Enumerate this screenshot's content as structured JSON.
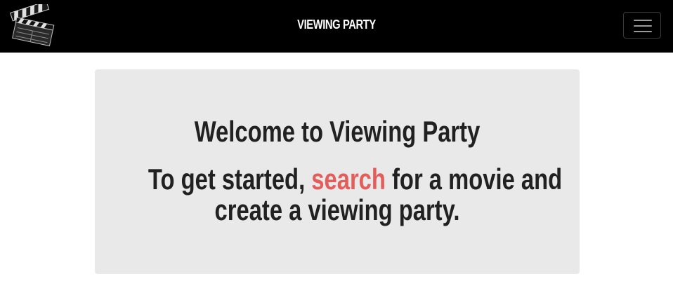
{
  "navbar": {
    "brand": "VIEWING PARTY",
    "logo_icon": "clapperboard-icon",
    "toggle_icon": "hamburger-menu-icon"
  },
  "jumbotron": {
    "welcome": "Welcome to Viewing Party",
    "lead_before": "To get started, ",
    "lead_link": "search",
    "lead_after_line1": " for a movie and",
    "lead_line2": "create a viewing party."
  },
  "colors": {
    "navbar_bg": "#000000",
    "jumbotron_bg": "#e9e9e9",
    "link": "#e35d5b",
    "text": "#212121"
  }
}
